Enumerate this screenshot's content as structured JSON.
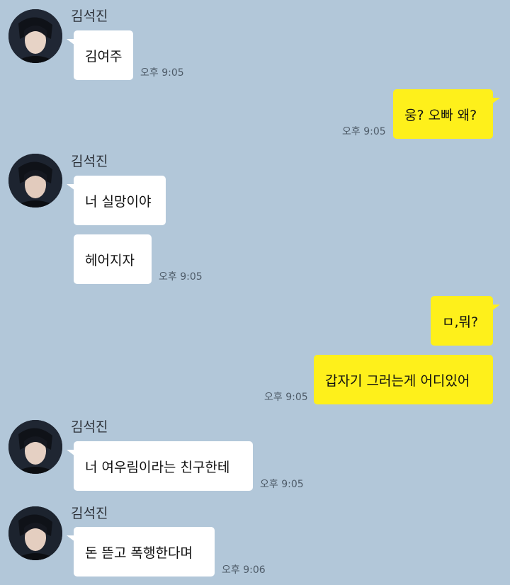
{
  "chat": {
    "sender_name": "김석진",
    "avatar_icon": "profile-photo",
    "colors": {
      "background": "#b2c7d9",
      "incoming_bubble": "#ffffff",
      "outgoing_bubble": "#fef01b",
      "timestamp": "#4e5b68"
    },
    "groups": [
      {
        "direction": "incoming",
        "sender": "김석진",
        "messages": [
          "김여주"
        ],
        "time": "오후 9:05"
      },
      {
        "direction": "outgoing",
        "messages": [
          "웅? 오빠 왜?"
        ],
        "time": "오후 9:05"
      },
      {
        "direction": "incoming",
        "sender": "김석진",
        "messages": [
          "너 실망이야",
          "헤어지자"
        ],
        "time": "오후 9:05"
      },
      {
        "direction": "outgoing",
        "messages": [
          "ㅁ,뭐?",
          "갑자기 그러는게 어디있어"
        ],
        "time": "오후 9:05"
      },
      {
        "direction": "incoming",
        "sender": "김석진",
        "messages": [
          "너 여우림이라는 친구한테"
        ],
        "time": "오후 9:05"
      },
      {
        "direction": "incoming",
        "sender": "김석진",
        "messages": [
          "돈 뜯고 폭행한다며"
        ],
        "time": "오후 9:06"
      }
    ]
  }
}
